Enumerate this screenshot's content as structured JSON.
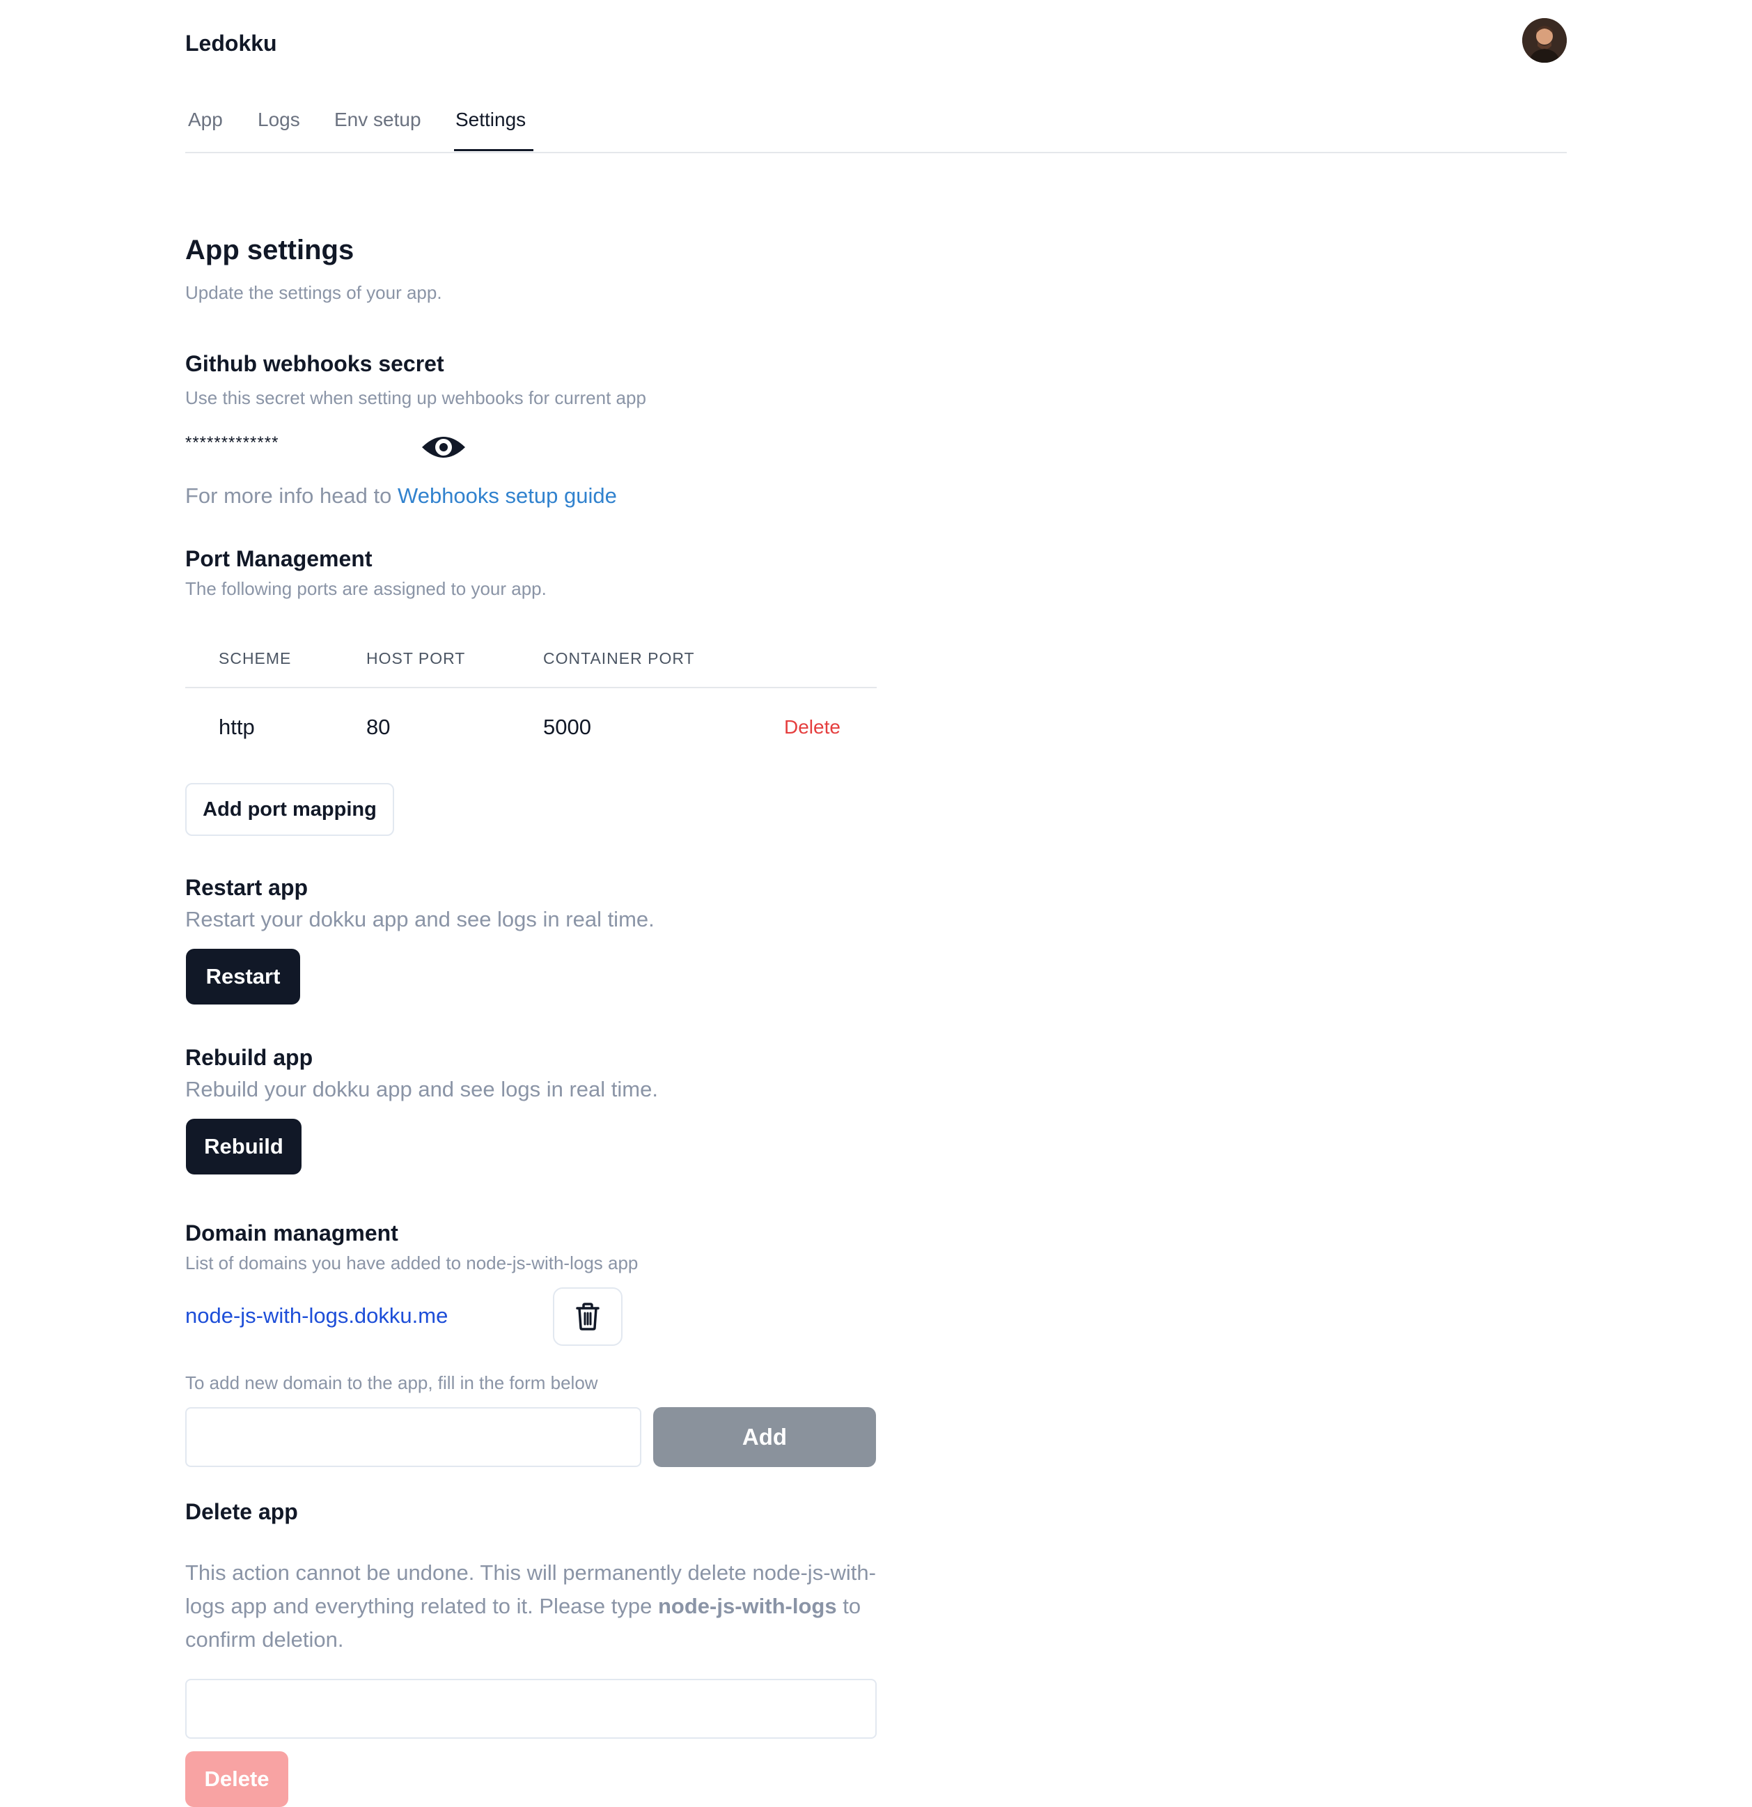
{
  "header": {
    "brand": "Ledokku",
    "avatar_icon": "user-avatar"
  },
  "tabs": [
    {
      "label": "App"
    },
    {
      "label": "Logs"
    },
    {
      "label": "Env setup"
    },
    {
      "label": "Settings",
      "active": true
    }
  ],
  "settings": {
    "title": "App settings",
    "subtitle": "Update the settings of your app."
  },
  "webhooks": {
    "title": "Github webhooks secret",
    "description": "Use this secret when setting up wehbooks for current app",
    "secret_masked": "*************",
    "eye_icon": "eye-icon",
    "info_prefix": "For more info head to",
    "info_link": "Webhooks setup guide"
  },
  "ports": {
    "title": "Port Management",
    "description": "The following ports are assigned to your app.",
    "headers": [
      "SCHEME",
      "HOST PORT",
      "CONTAINER PORT"
    ],
    "rows": [
      {
        "scheme": "http",
        "host_port": "80",
        "container_port": "5000",
        "action": "Delete"
      }
    ],
    "add_button": "Add port mapping"
  },
  "restart": {
    "title": "Restart app",
    "description": "Restart your dokku app and see logs in real time.",
    "button": "Restart"
  },
  "rebuild": {
    "title": "Rebuild app",
    "description": "Rebuild your dokku app and see logs in real time.",
    "button": "Rebuild"
  },
  "domains": {
    "title": "Domain managment",
    "description": "List of domains you have added to node-js-with-logs app",
    "items": [
      {
        "domain": "node-js-with-logs.dokku.me",
        "icon": "trash-icon"
      }
    ],
    "add_hint": "To add new domain to the app, fill in the form below",
    "input_value": "",
    "add_button": "Add"
  },
  "delete_app": {
    "title": "Delete app",
    "text_1": "This action cannot be undone. This will permanently delete node-js-with-logs app and everything related to it. Please type ",
    "app_name": "node-js-with-logs",
    "text_2": " to confirm deletion.",
    "input_value": "",
    "button": "Delete"
  },
  "colors": {
    "primary_dark": "#111827",
    "link_blue": "#3182ce",
    "domain_link": "#1d4ed8",
    "danger_text": "#e53e3e",
    "danger_disabled": "#f8a3a3",
    "add_disabled": "#8a929c"
  }
}
